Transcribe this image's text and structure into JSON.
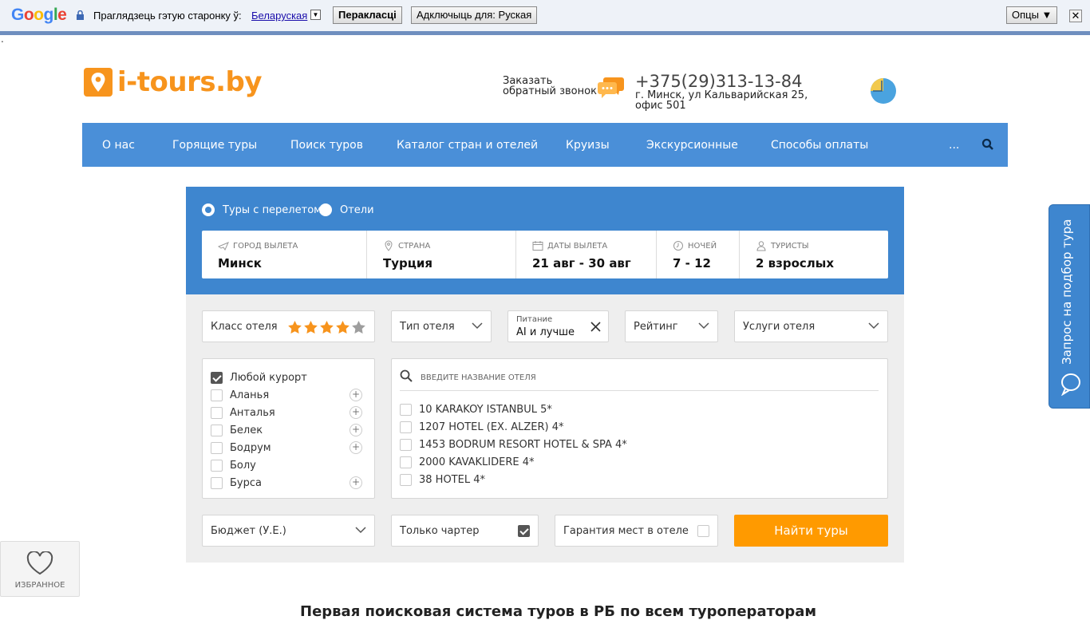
{
  "translate_bar": {
    "logo": "Google",
    "prompt": "Праглядзець гэтую старонку ў:",
    "language": "Беларуская",
    "translate_button": "Перакласці",
    "disable_button": "Адключыць для: Руская",
    "options_button": "Опцы ▼",
    "close": "✕"
  },
  "header": {
    "logo_text": "i-tours.by",
    "callback": "Заказать обратный звонок",
    "phone": "+375(29)313-13-84",
    "address": "г. Минск, ул Кальварийская 25, офис 501"
  },
  "nav": {
    "items": [
      "О нас",
      "Горящие туры",
      "Поиск туров",
      "Каталог стран и отелей",
      "Круизы",
      "Экскурсионные",
      "Способы оплаты"
    ],
    "more": "..."
  },
  "search": {
    "mode_tours": "Туры с перелетом",
    "mode_hotels": "Отели",
    "fields": [
      {
        "label": "Город вылета",
        "value": "Минск",
        "icon": "plane-icon"
      },
      {
        "label": "Страна",
        "value": "Турция",
        "icon": "location-icon"
      },
      {
        "label": "Даты вылета",
        "value": "21 авг - 30 авг",
        "icon": "calendar-icon"
      },
      {
        "label": "Ночей",
        "value": "7 - 12",
        "icon": "clock-icon"
      },
      {
        "label": "Туристы",
        "value": "2 взрослых",
        "icon": "user-icon"
      }
    ],
    "filters": {
      "hotel_class": "Класс отеля",
      "stars_selected": 4,
      "stars_total": 5,
      "hotel_type": "Тип отеля",
      "food_label": "Питание",
      "food_value": "AI и лучше",
      "rating": "Рейтинг",
      "services": "Услуги отеля"
    },
    "resorts": [
      {
        "name": "Любой курорт",
        "checked": true,
        "plus": false
      },
      {
        "name": "Аланья",
        "checked": false,
        "plus": true
      },
      {
        "name": "Анталья",
        "checked": false,
        "plus": true
      },
      {
        "name": "Белек",
        "checked": false,
        "plus": true
      },
      {
        "name": "Бодрум",
        "checked": false,
        "plus": true
      },
      {
        "name": "Болу",
        "checked": false,
        "plus": false
      },
      {
        "name": "Бурса",
        "checked": false,
        "plus": true
      }
    ],
    "hotel_search_placeholder": "ВВЕДИТЕ НАЗВАНИЕ ОТЕЛЯ",
    "hotels": [
      "10 KARAKOY ISTANBUL 5*",
      "1207 HOTEL (EX. ALZER) 4*",
      "1453 BODRUM RESORT HOTEL & SPA 4*",
      "2000 KAVAKLIDERE 4*",
      "38 HOTEL 4*"
    ],
    "budget": "Бюджет (У.Е.)",
    "charter_only": "Только чартер",
    "charter_checked": true,
    "guarantee": "Гарантия мест в отеле",
    "guarantee_checked": false,
    "find_button": "Найти туры"
  },
  "side_tab": "Запрос на подбор тура",
  "favorites": "ИЗБРАННОЕ",
  "bottom_title": "Первая поисковая система туров в РБ по всем туроператорам",
  "colors": {
    "brand_orange": "#f7941d",
    "nav_blue": "#4a8fd8",
    "panel_blue": "#3e86cf",
    "button_orange": "#ff9a00"
  }
}
